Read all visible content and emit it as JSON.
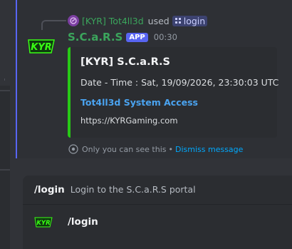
{
  "reply": {
    "user": "[KYR] Tot4ll3d",
    "used_text": "used",
    "command": "login"
  },
  "message": {
    "author": "S.C.a.R.S",
    "tag": "APP",
    "time": "00:30"
  },
  "embed": {
    "title": "[KYR] S.C.a.R.S",
    "description": "Date - Time : Sat, 19/09/2026, 23:30:03 UTC",
    "link_text": "Tot4ll3d System Access",
    "url_text": "https://KYRGaming.com"
  },
  "ephemeral": {
    "notice": "Only you can see this",
    "separator": "•",
    "dismiss": "Dismiss message"
  },
  "autocomplete": {
    "command": "/login",
    "description": "Login to the S.C.a.R.S portal",
    "option_label": "/login"
  },
  "colors": {
    "embed_accent": "#27c916",
    "author": "#3ba55c",
    "app_tag": "#5865f2",
    "link": "#4aa3f0"
  }
}
